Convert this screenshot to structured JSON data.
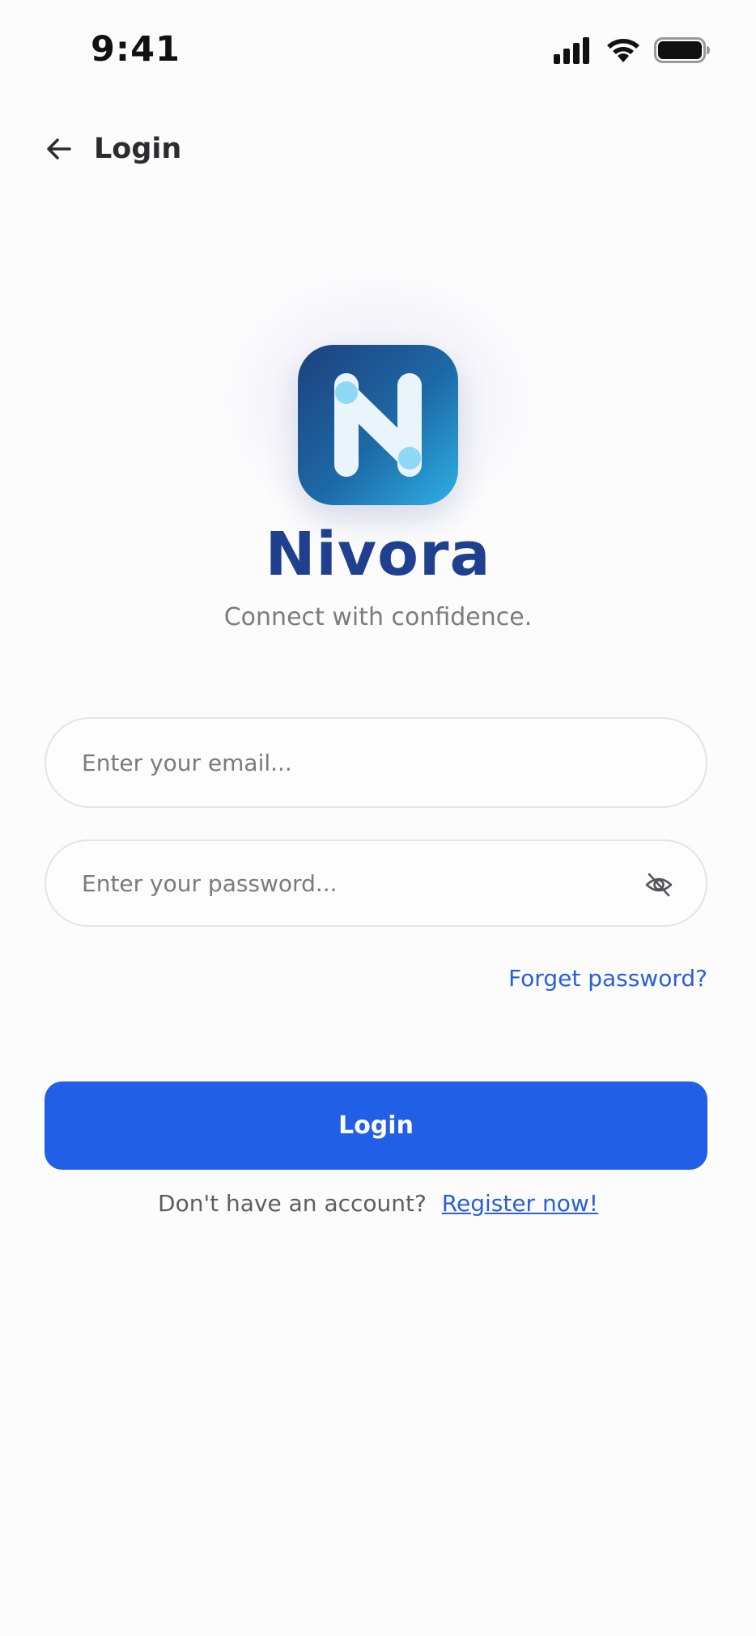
{
  "status_bar": {
    "time": "9:41",
    "icons": [
      "signal-icon",
      "wifi-icon",
      "battery-icon"
    ]
  },
  "header": {
    "title": "Login",
    "back_icon": "arrow-left-icon"
  },
  "brand": {
    "logo_icon": "nivora-n-logo",
    "name": "Nivora",
    "tagline": "Connect with confidence."
  },
  "form": {
    "email": {
      "value": "",
      "placeholder": "Enter your email..."
    },
    "password": {
      "value": "",
      "placeholder": "Enter your password...",
      "toggle_icon": "eye-off-icon"
    },
    "forgot_label": "Forget password?",
    "submit_label": "Login"
  },
  "register": {
    "prompt": "Don't have an account?",
    "link_label": "Register now!"
  },
  "colors": {
    "primary": "#2160e6",
    "brand_text": "#1f3f8f",
    "link": "#2a5fd8",
    "logo_gradient_start": "#1e3f7e",
    "logo_gradient_end": "#2eb0e6"
  }
}
